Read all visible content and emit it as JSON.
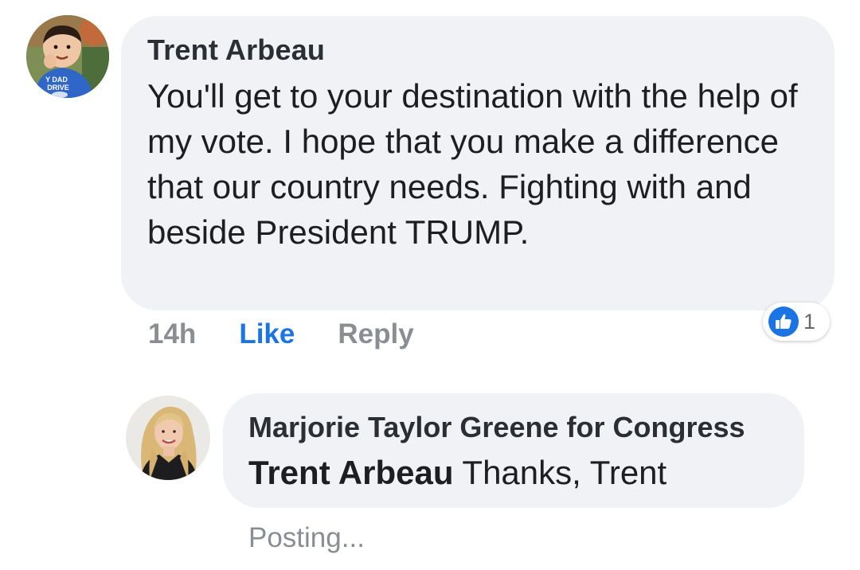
{
  "comment": {
    "author": "Trent Arbeau",
    "text": "You'll get to your destination with the help of my vote. I hope that you make a difference that our country needs. Fighting with and beside President TRUMP.",
    "time": "14h",
    "like_label": "Like",
    "reply_label": "Reply",
    "reaction_count": "1",
    "avatar_shirt_text_line1": "Y DAD",
    "avatar_shirt_text_line2": "DRIVE"
  },
  "reply": {
    "author": "Marjorie Taylor Greene for Congress",
    "mention": "Trent Arbeau",
    "text": "Thanks, Trent",
    "status": "Posting..."
  },
  "colors": {
    "bubble": "#f0f2f5",
    "link_blue": "#1b74e4",
    "meta_gray": "#8a8d91"
  }
}
